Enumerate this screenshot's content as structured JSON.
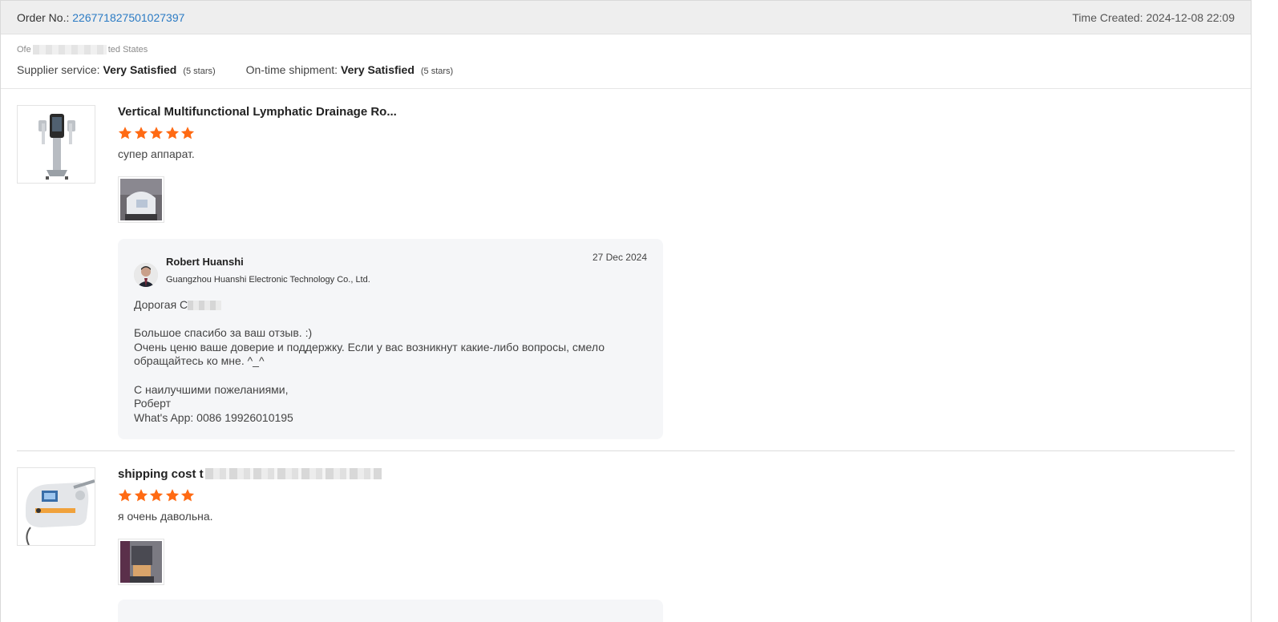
{
  "header": {
    "order_label": "Order No.:",
    "order_number": "226771827501027397",
    "time_created": "Time Created: 2024-12-08 22:09"
  },
  "summary": {
    "buyer_prefix": "Ofe",
    "buyer_suffix": "ted States",
    "supplier_service_label": "Supplier service:",
    "supplier_service_value": "Very Satisfied",
    "supplier_service_note": "(5 stars)",
    "shipment_label": "On-time shipment:",
    "shipment_value": "Very Satisfied",
    "shipment_note": "(5 stars)"
  },
  "reviews": [
    {
      "product_title": "Vertical Multifunctional Lymphatic Drainage Ro...",
      "stars": 5,
      "comment": "супер аппарат.",
      "reply": {
        "name": "Robert Huanshi",
        "company": "Guangzhou Huanshi Electronic Technology Co., Ltd.",
        "date": "27 Dec 2024",
        "greeting": "Дорогая С",
        "line1": "Большое спасибо за ваш отзыв. :)",
        "line2": "Очень ценю ваше доверие и поддержку. Если у вас возникнут какие-либо вопросы, смело обращайтесь ко мне. ^_^",
        "line3": "С наилучшими пожеланиями,",
        "line4": "Роберт",
        "line5": "What's App: 0086 19926010195"
      }
    },
    {
      "product_title": "shipping cost t",
      "stars": 5,
      "comment": "я очень давольна."
    }
  ],
  "colors": {
    "star": "#ff6a13",
    "link": "#2b7bc4",
    "header_bg": "#eeeeee",
    "reply_bg": "#f5f6f8"
  },
  "icons": {
    "star": "star-icon",
    "avatar": "avatar"
  }
}
